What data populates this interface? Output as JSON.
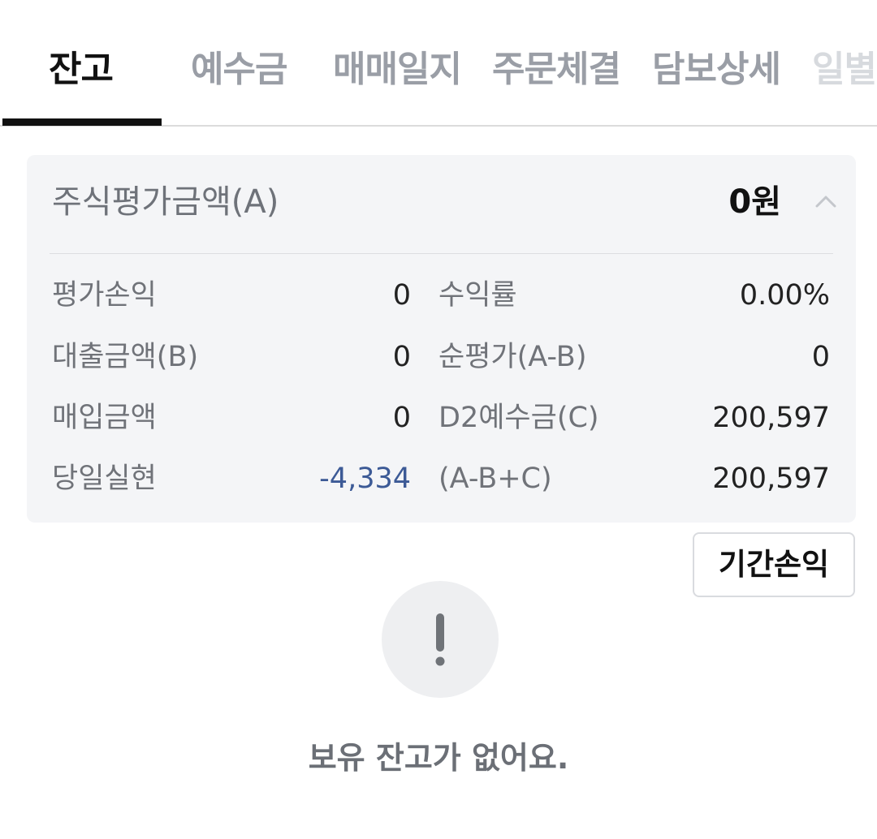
{
  "tabs": [
    {
      "label": "잔고",
      "active": true
    },
    {
      "label": "예수금",
      "active": false
    },
    {
      "label": "매매일지",
      "active": false
    },
    {
      "label": "주문체결",
      "active": false
    },
    {
      "label": "담보상세",
      "active": false
    },
    {
      "label": "일별",
      "active": false
    }
  ],
  "summary": {
    "title": "주식평가금액(A)",
    "total": "0원",
    "rows": [
      {
        "left_label": "평가손익",
        "left_value": "0",
        "right_label": "수익률",
        "right_value": "0.00%"
      },
      {
        "left_label": "대출금액(B)",
        "left_value": "0",
        "right_label": "순평가(A-B)",
        "right_value": "0"
      },
      {
        "left_label": "매입금액",
        "left_value": "0",
        "right_label": "D2예수금(C)",
        "right_value": "200,597"
      },
      {
        "left_label": "당일실현",
        "left_value": "-4,334",
        "right_label": "(A-B+C)",
        "right_value": "200,597"
      }
    ]
  },
  "period_button": {
    "label": "기간손익"
  },
  "empty_state": {
    "icon": "exclamation-icon",
    "message": "보유 잔고가 없어요."
  },
  "colors": {
    "accent": "#111111",
    "negative": "#3c5a96",
    "card_bg": "#f4f5f7",
    "tab_inactive": "#9a9ea6"
  }
}
